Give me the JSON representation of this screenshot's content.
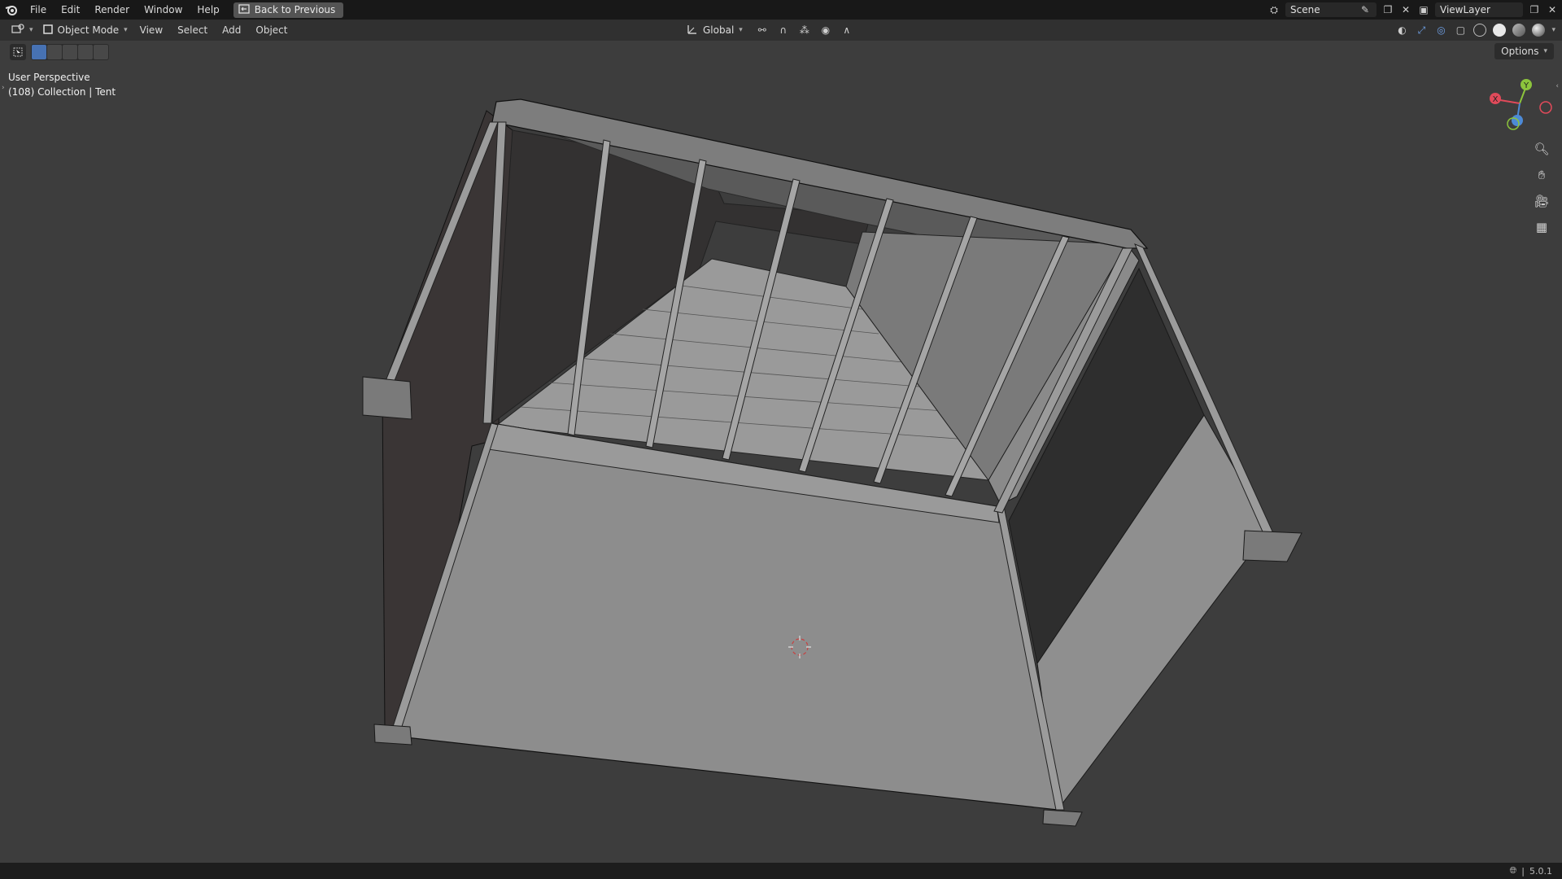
{
  "menu": [
    "File",
    "Edit",
    "Render",
    "Window",
    "Help"
  ],
  "back_button": "Back to Previous",
  "scene_field": "Scene",
  "viewlayer_field": "ViewLayer",
  "header": {
    "mode": "Object Mode",
    "menus": [
      "View",
      "Select",
      "Add",
      "Object"
    ],
    "orientation": "Global"
  },
  "options_label": "Options",
  "viewport": {
    "perspective": "User Perspective",
    "collection": "(108) Collection | Tent"
  },
  "gizmo": {
    "x": "X",
    "y": "Y",
    "z": "Z"
  },
  "status": {
    "version": "5.0.1"
  },
  "colors": {
    "accent": "#4772b3",
    "x_axis": "#e04a5a",
    "y_axis": "#8cc43c",
    "z_axis": "#4d8ad6"
  }
}
